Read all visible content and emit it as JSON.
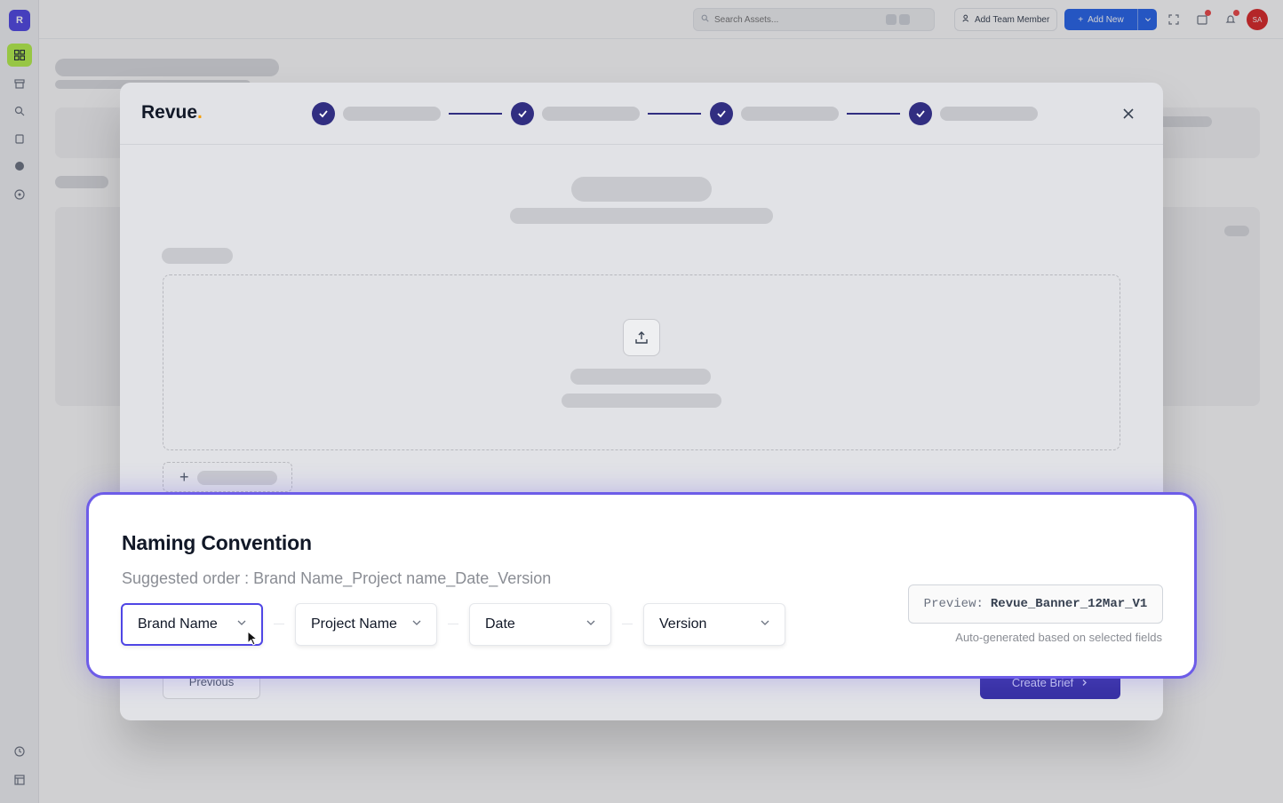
{
  "app": {
    "logo_letter": "R",
    "brand_name": "Revue",
    "brand_dot": ".",
    "accent_color": "#4f46e5"
  },
  "topbar": {
    "search_placeholder": "Search Assets...",
    "add_team_label": "Add Team Member",
    "add_new_label": "Add New",
    "avatar_initials": "SA"
  },
  "sidebar": {
    "items": [
      "grid-icon",
      "archive-icon",
      "search-icon",
      "trash-icon",
      "globe-icon",
      "help-icon",
      "clock-icon",
      "layout-icon"
    ]
  },
  "wizard": {
    "steps_completed": 4,
    "previous_label": "Previous",
    "create_label": "Create Brief"
  },
  "naming": {
    "title": "Naming Convention",
    "subtitle": "Suggested order : Brand Name_Project name_Date_Version",
    "fields": [
      "Brand Name",
      "Project Name",
      "Date",
      "Version"
    ],
    "preview_label": "Preview:",
    "preview_value": "Revue_Banner_12Mar_V1",
    "preview_note": "Auto-generated based on selected fields"
  }
}
